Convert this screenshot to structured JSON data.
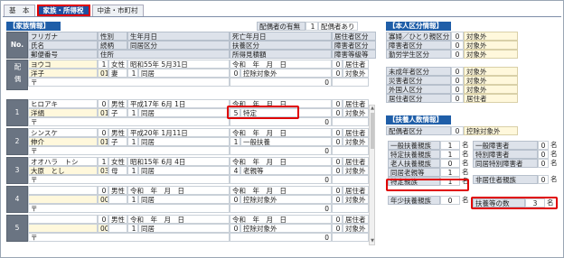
{
  "tabs": [
    "基　本",
    "家族・所得税",
    "中途・市町村"
  ],
  "family": {
    "title": "【家族情報】",
    "spouse_label": "配偶者の有無",
    "spouse_count": "1",
    "spouse_status": "配偶者あり",
    "headers": {
      "no": "No.",
      "row1": [
        "フリガナ",
        "性別",
        "生年月日",
        "死亡年月日",
        "居住者区分"
      ],
      "row2": [
        "氏名",
        "続柄",
        "同居区分",
        "扶養区分",
        "障害者区分"
      ],
      "row3": [
        "郵便番号",
        "住所",
        "",
        "所得見積額",
        "障害等級等"
      ]
    },
    "spouse_row": {
      "label": "配偶",
      "kana": "ヨウコ",
      "sex_code": "1",
      "sex": "女性",
      "birth": "昭和55年 5月31日",
      "death": "令和　年　月　日",
      "res_code": "0",
      "res": "居住者",
      "name": "洋子",
      "rel_code": "01",
      "rel": "妻",
      "cohab_code": "1",
      "cohab": "同居",
      "dep_code": "0",
      "dep": "控除対象外",
      "dis_code": "0",
      "dis": "対象外",
      "zip": "〒",
      "income": "0",
      "grade": ""
    },
    "members": [
      {
        "no": "1",
        "kana": "ヒロアキ",
        "sex_code": "0",
        "sex": "男性",
        "birth": "平成17年 6月 1日",
        "death": "令和　年　月　日",
        "res_code": "0",
        "res": "居住者",
        "name": "洋絹",
        "rel_code": "01",
        "rel": "子",
        "cohab_code": "1",
        "cohab": "同居",
        "dep_code": "5",
        "dep": "特定",
        "dis_code": "0",
        "dis": "対象外",
        "zip": "〒",
        "income": "0"
      },
      {
        "no": "2",
        "kana": "シンスケ",
        "sex_code": "0",
        "sex": "男性",
        "birth": "平成20年 1月11日",
        "death": "令和　年　月　日",
        "res_code": "0",
        "res": "居住者",
        "name": "伸介",
        "rel_code": "01",
        "rel": "子",
        "cohab_code": "1",
        "cohab": "同居",
        "dep_code": "1",
        "dep": "一般扶養",
        "dis_code": "0",
        "dis": "対象外",
        "zip": "〒",
        "income": "0"
      },
      {
        "no": "3",
        "kana": "オオハラ　トシ",
        "sex_code": "1",
        "sex": "女性",
        "birth": "昭和15年 6月 4日",
        "death": "令和　年　月　日",
        "res_code": "0",
        "res": "居住者",
        "name": "大原　とし",
        "rel_code": "03",
        "rel": "母",
        "cohab_code": "1",
        "cohab": "同居",
        "dep_code": "4",
        "dep": "老親等",
        "dis_code": "0",
        "dis": "対象外",
        "zip": "〒",
        "income": "0"
      },
      {
        "no": "4",
        "kana": "",
        "sex_code": "0",
        "sex": "男性",
        "birth": "令和　年　月　日",
        "death": "令和　年　月　日",
        "res_code": "0",
        "res": "居住者",
        "name": "",
        "rel_code": "00",
        "rel": "",
        "cohab_code": "1",
        "cohab": "同居",
        "dep_code": "0",
        "dep": "控除対象外",
        "dis_code": "0",
        "dis": "対象外",
        "zip": "〒",
        "income": "0"
      },
      {
        "no": "5",
        "kana": "",
        "sex_code": "0",
        "sex": "男性",
        "birth": "令和　年　月　日",
        "death": "令和　年　月　日",
        "res_code": "0",
        "res": "居住者",
        "name": "",
        "rel_code": "00",
        "rel": "",
        "cohab_code": "1",
        "cohab": "同居",
        "dep_code": "0",
        "dep": "控除対象外",
        "dis_code": "0",
        "dis": "対象外",
        "zip": "〒",
        "income": "0"
      }
    ]
  },
  "self": {
    "title": "【本人区分情報】",
    "items": [
      {
        "label": "寡婦／ひとり親区分",
        "code": "0",
        "value": "対象外"
      },
      {
        "label": "障害者区分",
        "code": "0",
        "value": "対象外"
      },
      {
        "label": "勤労学生区分",
        "code": "0",
        "value": "対象外"
      },
      {
        "label": "未成年者区分",
        "code": "0",
        "value": "対象外"
      },
      {
        "label": "災害者区分",
        "code": "0",
        "value": "対象外"
      },
      {
        "label": "外国人区分",
        "code": "0",
        "value": "対象外"
      },
      {
        "label": "居住者区分",
        "code": "0",
        "value": "居住者"
      }
    ]
  },
  "dependents": {
    "title": "【扶養人数情報】",
    "spouse_label": "配偶者区分",
    "spouse_code": "0",
    "spouse_value": "控除対象外",
    "left": [
      {
        "label": "一般扶養親族",
        "count": "1",
        "unit": "名"
      },
      {
        "label": "特定扶養親族",
        "count": "1",
        "unit": "名"
      },
      {
        "label": "老人扶養親族",
        "count": "0",
        "unit": "名"
      },
      {
        "label": "同居老親等",
        "count": "1",
        "unit": "名"
      },
      {
        "label": "特定親族",
        "count": "1",
        "unit": "名"
      },
      {
        "label": "年少扶養親族",
        "count": "0",
        "unit": "名"
      }
    ],
    "right": [
      {
        "label": "一般障害者",
        "count": "0",
        "unit": "名"
      },
      {
        "label": "特別障害者",
        "count": "0",
        "unit": "名"
      },
      {
        "label": "同居特別障害者",
        "count": "0",
        "unit": "名"
      },
      {
        "label": "非居住者親族",
        "count": "0",
        "unit": "名"
      }
    ],
    "total_label": "扶養等の数",
    "total": "3",
    "total_unit": "名"
  }
}
